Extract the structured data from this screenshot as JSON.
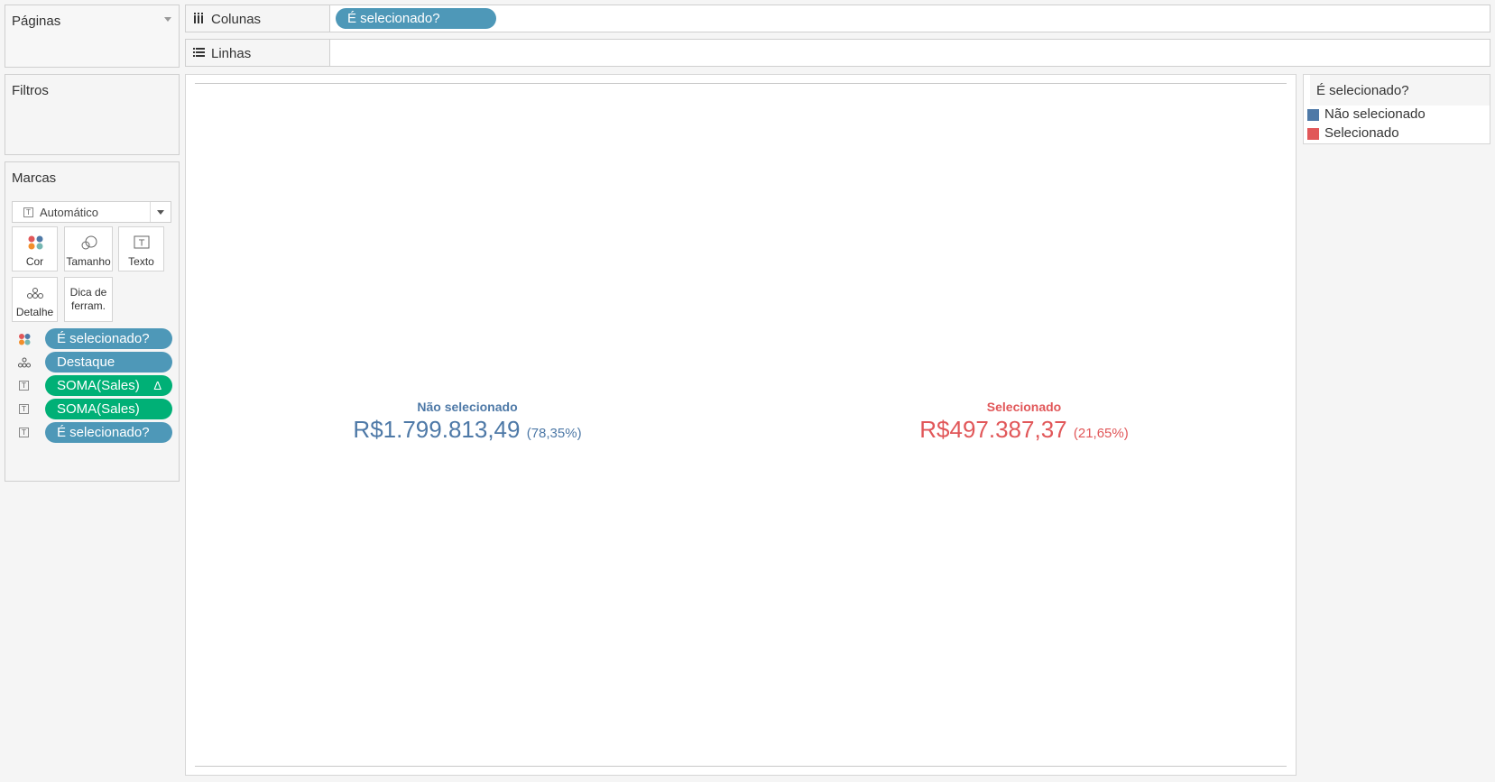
{
  "panels": {
    "paginas": "Páginas",
    "filtros": "Filtros",
    "marcas": "Marcas"
  },
  "marks": {
    "type": "Automático",
    "buttons": [
      "Cor",
      "Tamanho",
      "Texto",
      "Detalhe",
      "Dica de\nferram."
    ],
    "pills": [
      {
        "label": "É selecionado?",
        "icon": "color-icon",
        "color": "blue"
      },
      {
        "label": "Destaque",
        "icon": "detail-icon",
        "color": "blue"
      },
      {
        "label": "SOMA(Sales)",
        "icon": "text-icon",
        "color": "green",
        "delta": "Δ"
      },
      {
        "label": "SOMA(Sales)",
        "icon": "text-icon",
        "color": "green"
      },
      {
        "label": "É selecionado?",
        "icon": "text-icon",
        "color": "blue"
      }
    ]
  },
  "shelves": {
    "colunas": {
      "label": "Colunas",
      "pill": "É selecionado?"
    },
    "linhas": {
      "label": "Linhas"
    }
  },
  "view": {
    "cells": [
      {
        "category": "Não selecionado",
        "value": "R$1.799.813,49",
        "pct": "(78,35%)",
        "color": "#4e79a7"
      },
      {
        "category": "Selecionado",
        "value": "R$497.387,37",
        "pct": "(21,65%)",
        "color": "#e15759"
      }
    ]
  },
  "legend": {
    "title": "É selecionado?",
    "items": [
      {
        "label": "Não selecionado",
        "color": "#4e79a7"
      },
      {
        "label": "Selecionado",
        "color": "#e15759"
      }
    ]
  },
  "colors": {
    "pill_blue": "#4e98b8",
    "pill_green": "#00b076"
  }
}
